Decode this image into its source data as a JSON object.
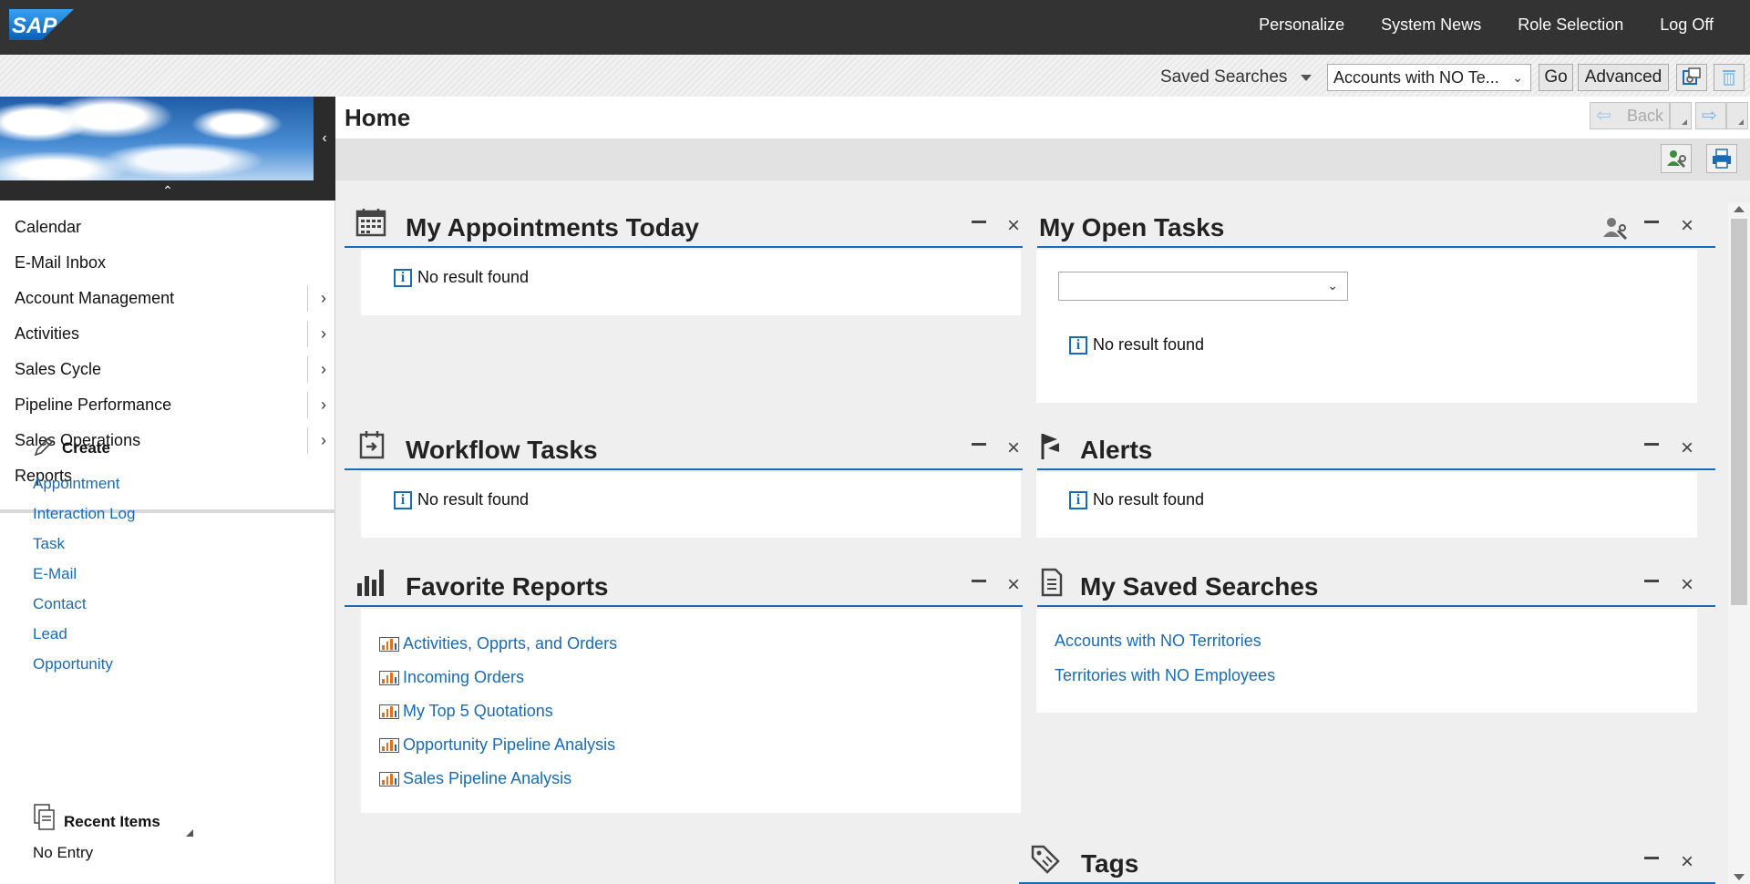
{
  "brand": "SAP",
  "topnav": [
    "Personalize",
    "System News",
    "Role Selection",
    "Log Off"
  ],
  "search": {
    "saved_label": "Saved Searches",
    "selected": "Accounts with NO Te...",
    "go": "Go",
    "advanced": "Advanced"
  },
  "sidebar": {
    "items": [
      {
        "label": "Calendar",
        "has_arrow": false
      },
      {
        "label": "E-Mail Inbox",
        "has_arrow": false
      },
      {
        "label": "Account Management",
        "has_arrow": true
      },
      {
        "label": "Activities",
        "has_arrow": true
      },
      {
        "label": "Sales Cycle",
        "has_arrow": true
      },
      {
        "label": "Pipeline Performance",
        "has_arrow": true
      },
      {
        "label": "Sales Operations",
        "has_arrow": true
      },
      {
        "label": "Reports",
        "has_arrow": false
      }
    ],
    "create_title": "Create",
    "create_items": [
      "Appointment",
      "Interaction Log",
      "Task",
      "E-Mail",
      "Contact",
      "Lead",
      "Opportunity"
    ],
    "recent_title": "Recent Items",
    "recent_empty": "No Entry"
  },
  "main": {
    "title": "Home",
    "back": "Back"
  },
  "panels": {
    "appointments": {
      "title": "My Appointments Today",
      "empty": "No result found"
    },
    "open_tasks": {
      "title": "My Open Tasks",
      "empty": "No result found"
    },
    "workflow": {
      "title": "Workflow Tasks",
      "empty": "No result found"
    },
    "alerts": {
      "title": "Alerts",
      "empty": "No result found"
    },
    "favorites": {
      "title": "Favorite Reports",
      "items": [
        "Activities, Opprts, and Orders",
        "Incoming Orders",
        "My Top 5 Quotations",
        "Opportunity Pipeline Analysis",
        "Sales Pipeline Analysis"
      ]
    },
    "saved_searches": {
      "title": "My Saved Searches",
      "items": [
        "Accounts with NO Territories",
        "Territories with NO Employees"
      ]
    },
    "tags": {
      "title": "Tags"
    }
  },
  "colors": {
    "accent": "#1a6bb5",
    "topbar": "#333333",
    "sap_blue": "#1a7fd4"
  }
}
